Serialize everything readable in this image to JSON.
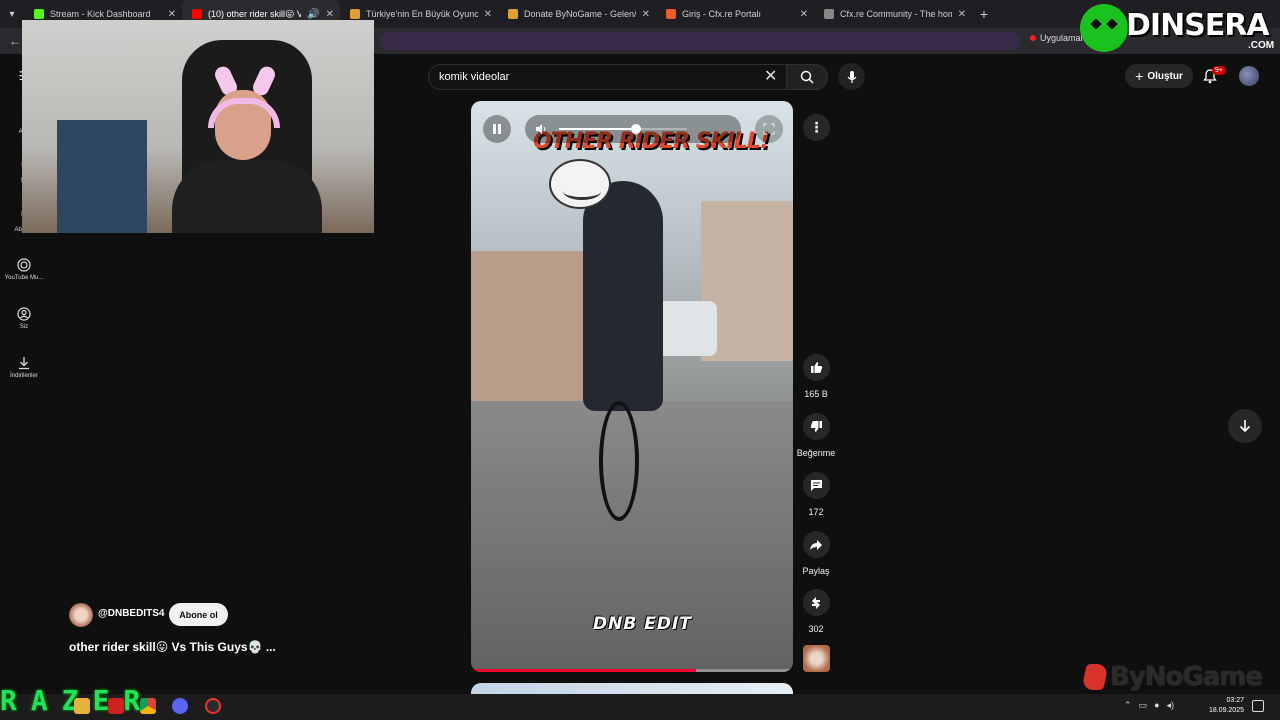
{
  "browser": {
    "tabs": [
      {
        "title": "Stream - Kick Dashboard",
        "favicon_color": "#53fc18",
        "active": false
      },
      {
        "title": "(10) other rider skill😛 Vs T",
        "favicon_color": "#ff0000",
        "active": true
      },
      {
        "title": "Türkiye'nin En Büyük Oyuncu D",
        "favicon_color": "#e0a030",
        "active": false
      },
      {
        "title": "Donate ByNoGame - Gelen/Gid",
        "favicon_color": "#e0a030",
        "active": false
      },
      {
        "title": "Giriş - Cfx.re Portalı",
        "favicon_color": "#f05a28",
        "active": false
      },
      {
        "title": "Cfx.re Community - The home",
        "favicon_color": "#888888",
        "active": false
      }
    ],
    "apps_label": "Uygulamal"
  },
  "overlay_logo": {
    "word": "DINSERA",
    "suffix": ".COM"
  },
  "header": {
    "search_value": "komik videolar",
    "create_label": "Oluştur",
    "notification_count": "9+"
  },
  "sidebar": {
    "items": [
      {
        "label": "Ana",
        "icon": "home-icon"
      },
      {
        "label": "Sh",
        "icon": "shorts-icon"
      },
      {
        "label": "Abon...",
        "icon": "subscriptions-icon"
      },
      {
        "label": "YouTube Mu...",
        "icon": "youtube-music-icon"
      },
      {
        "label": "Siz",
        "icon": "account-icon"
      },
      {
        "label": "İndirilenler",
        "icon": "download-icon"
      }
    ]
  },
  "short": {
    "overlay_title": "OTHER RIDER SKILL!",
    "caption": "DNB EDIT",
    "volume_level": 0.6,
    "progress": 0.7,
    "channel": "@DNBEDITS4",
    "subscribe_label": "Abone ol",
    "title": "other rider skill😛 Vs This Guys💀 ...",
    "actions": {
      "likes": "165 B",
      "dislike_label": "Beğenme",
      "comments": "172",
      "share_label": "Paylaş",
      "remix_count": "302"
    }
  },
  "watermark": "ByNoGame",
  "taskbar": {
    "brand": "RAZER",
    "time": "03:27",
    "date": "18.09.2025"
  },
  "colors": {
    "accent": "#ff0033",
    "brand_green": "#19c21f",
    "razer_green": "#22e25a"
  }
}
